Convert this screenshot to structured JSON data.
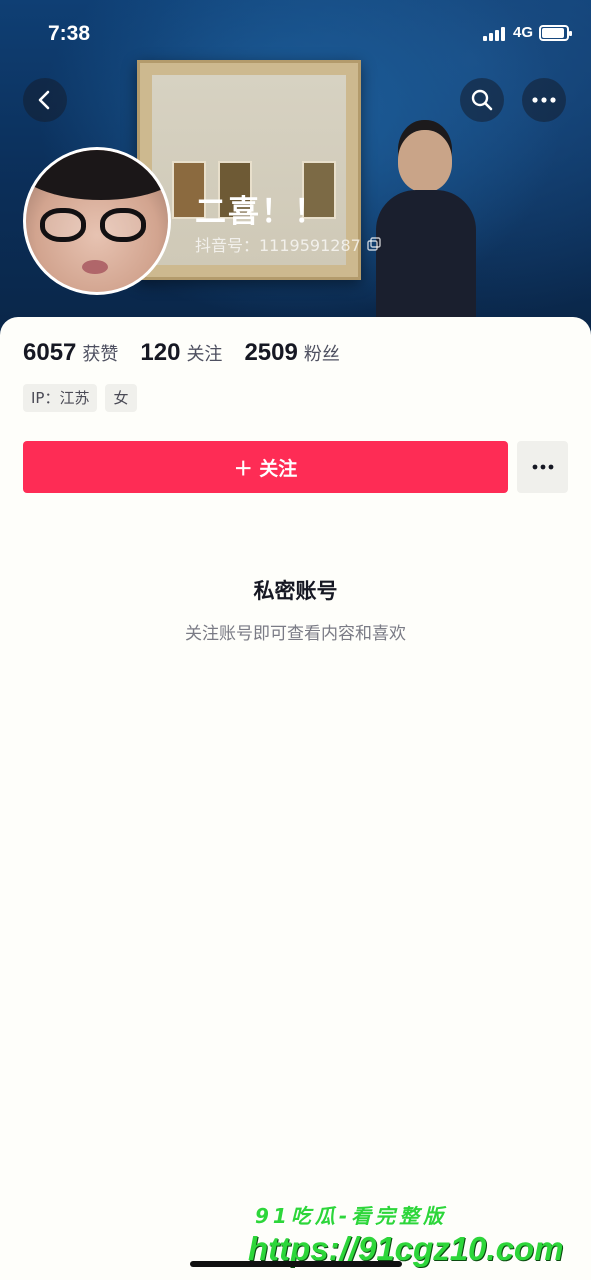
{
  "status_bar": {
    "time": "7:38",
    "network": "4G",
    "signal_bars": 4,
    "battery_level": 0.9
  },
  "profile": {
    "display_name": "二喜！！",
    "douyin_id": "抖音号：1119591287"
  },
  "stats": [
    {
      "value": "6057",
      "label": "获赞"
    },
    {
      "value": "120",
      "label": "关注"
    },
    {
      "value": "2509",
      "label": "粉丝"
    }
  ],
  "tags": [
    "IP：江苏",
    "女"
  ],
  "actions": {
    "follow_label": "＋ 关注"
  },
  "private": {
    "title": "私密账号",
    "description": "关注账号即可查看内容和喜欢"
  },
  "watermark": {
    "line1": "91吃瓜-看完整版",
    "line2": "https://91cgz10.com"
  },
  "icons": {
    "back": "chevron-left-icon",
    "search": "search-icon",
    "more": "more-horizontal-icon",
    "copy": "copy-icon"
  },
  "colors": {
    "accent": "#fe2c55",
    "banner": "#0f3f74",
    "watermark": "#2dd63a"
  }
}
